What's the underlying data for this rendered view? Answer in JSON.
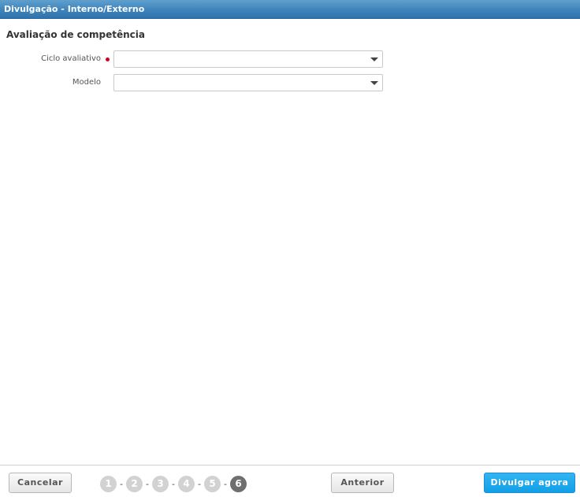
{
  "window": {
    "title": "Divulgação - Interno/Externo"
  },
  "section": {
    "title": "Avaliação de competência"
  },
  "form": {
    "fields": [
      {
        "label": "Ciclo avaliativo",
        "required": true,
        "value": ""
      },
      {
        "label": "Modelo",
        "required": false,
        "value": ""
      }
    ]
  },
  "footer": {
    "cancel_label": "Cancelar",
    "previous_label": "Anterior",
    "publish_label": "Divulgar agora",
    "steps": [
      "1",
      "2",
      "3",
      "4",
      "5",
      "6"
    ],
    "separator": "-",
    "current_step": 6
  },
  "colors": {
    "titlebar": "#3f84bb",
    "required_marker": "#d0021b",
    "primary_button": "#129fe6",
    "step_inactive": "#d2d2d2",
    "step_active": "#6f6f6f"
  }
}
